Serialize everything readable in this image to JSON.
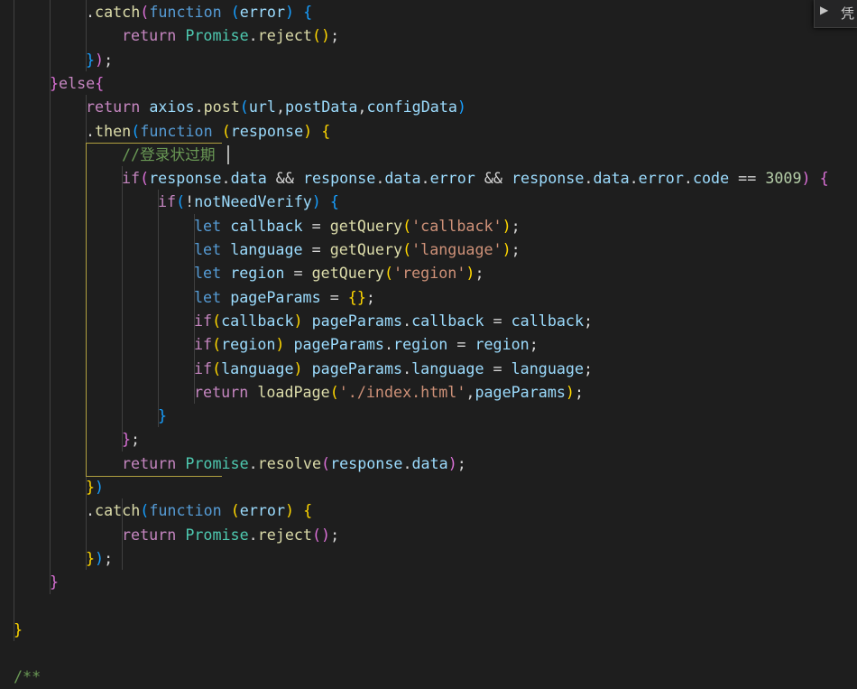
{
  "colors": {
    "background": "#1e1e1e",
    "default": "#d4d4d4",
    "keyword": "#c586c0",
    "storage": "#569cd6",
    "function": "#dcdcaa",
    "variable": "#9cdcfe",
    "class": "#4ec9b0",
    "string": "#ce9178",
    "number": "#b5cea8",
    "comment": "#6a9955",
    "bracket1": "#ffd700",
    "bracket2": "#da70d6",
    "bracket3": "#179fff"
  },
  "find_widget": {
    "toggle_icon": "chevron-right-icon",
    "label": "凭"
  },
  "lines": [
    [
      {
        "t": ".",
        "k": "default"
      },
      {
        "t": "catch",
        "k": "function"
      },
      {
        "t": "(",
        "k": "bracket2"
      },
      {
        "t": "function",
        "k": "storage"
      },
      {
        "t": " ",
        "k": "default"
      },
      {
        "t": "(",
        "k": "bracket3"
      },
      {
        "t": "error",
        "k": "variable"
      },
      {
        "t": ")",
        "k": "bracket3"
      },
      {
        "t": " ",
        "k": "default"
      },
      {
        "t": "{",
        "k": "bracket3"
      }
    ],
    [
      {
        "t": "return",
        "k": "keyword"
      },
      {
        "t": " ",
        "k": "default"
      },
      {
        "t": "Promise",
        "k": "class"
      },
      {
        "t": ".",
        "k": "default"
      },
      {
        "t": "reject",
        "k": "function"
      },
      {
        "t": "(",
        "k": "bracket1"
      },
      {
        "t": ")",
        "k": "bracket1"
      },
      {
        "t": ";",
        "k": "default"
      }
    ],
    [
      {
        "t": "}",
        "k": "bracket3"
      },
      {
        "t": ")",
        "k": "bracket2"
      },
      {
        "t": ";",
        "k": "default"
      }
    ],
    [
      {
        "t": "}",
        "k": "bracket2"
      },
      {
        "t": "else",
        "k": "keyword"
      },
      {
        "t": "{",
        "k": "bracket2"
      }
    ],
    [
      {
        "t": "return",
        "k": "keyword"
      },
      {
        "t": " ",
        "k": "default"
      },
      {
        "t": "axios",
        "k": "variable"
      },
      {
        "t": ".",
        "k": "default"
      },
      {
        "t": "post",
        "k": "function"
      },
      {
        "t": "(",
        "k": "bracket3"
      },
      {
        "t": "url",
        "k": "variable"
      },
      {
        "t": ",",
        "k": "default"
      },
      {
        "t": "postData",
        "k": "variable"
      },
      {
        "t": ",",
        "k": "default"
      },
      {
        "t": "configData",
        "k": "variable"
      },
      {
        "t": ")",
        "k": "bracket3"
      }
    ],
    [
      {
        "t": ".",
        "k": "default"
      },
      {
        "t": "then",
        "k": "function"
      },
      {
        "t": "(",
        "k": "bracket3"
      },
      {
        "t": "function",
        "k": "storage"
      },
      {
        "t": " ",
        "k": "default"
      },
      {
        "t": "(",
        "k": "bracket1"
      },
      {
        "t": "response",
        "k": "variable"
      },
      {
        "t": ")",
        "k": "bracket1"
      },
      {
        "t": " ",
        "k": "default"
      },
      {
        "t": "{",
        "k": "bracket1"
      }
    ],
    [
      {
        "t": "//登录状过期",
        "k": "comment"
      }
    ],
    [
      {
        "t": "if",
        "k": "keyword"
      },
      {
        "t": "(",
        "k": "bracket2"
      },
      {
        "t": "response",
        "k": "variable"
      },
      {
        "t": ".",
        "k": "default"
      },
      {
        "t": "data",
        "k": "variable"
      },
      {
        "t": " && ",
        "k": "default"
      },
      {
        "t": "response",
        "k": "variable"
      },
      {
        "t": ".",
        "k": "default"
      },
      {
        "t": "data",
        "k": "variable"
      },
      {
        "t": ".",
        "k": "default"
      },
      {
        "t": "error",
        "k": "variable"
      },
      {
        "t": " && ",
        "k": "default"
      },
      {
        "t": "response",
        "k": "variable"
      },
      {
        "t": ".",
        "k": "default"
      },
      {
        "t": "data",
        "k": "variable"
      },
      {
        "t": ".",
        "k": "default"
      },
      {
        "t": "error",
        "k": "variable"
      },
      {
        "t": ".",
        "k": "default"
      },
      {
        "t": "code",
        "k": "variable"
      },
      {
        "t": " == ",
        "k": "default"
      },
      {
        "t": "3009",
        "k": "number"
      },
      {
        "t": ")",
        "k": "bracket2"
      },
      {
        "t": " ",
        "k": "default"
      },
      {
        "t": "{",
        "k": "bracket2"
      }
    ],
    [
      {
        "t": "if",
        "k": "keyword"
      },
      {
        "t": "(",
        "k": "bracket3"
      },
      {
        "t": "!",
        "k": "default"
      },
      {
        "t": "notNeedVerify",
        "k": "variable"
      },
      {
        "t": ")",
        "k": "bracket3"
      },
      {
        "t": " ",
        "k": "default"
      },
      {
        "t": "{",
        "k": "bracket3"
      }
    ],
    [
      {
        "t": "let",
        "k": "storage"
      },
      {
        "t": " ",
        "k": "default"
      },
      {
        "t": "callback",
        "k": "variable"
      },
      {
        "t": " = ",
        "k": "default"
      },
      {
        "t": "getQuery",
        "k": "function"
      },
      {
        "t": "(",
        "k": "bracket1"
      },
      {
        "t": "'callback'",
        "k": "string"
      },
      {
        "t": ")",
        "k": "bracket1"
      },
      {
        "t": ";",
        "k": "default"
      }
    ],
    [
      {
        "t": "let",
        "k": "storage"
      },
      {
        "t": " ",
        "k": "default"
      },
      {
        "t": "language",
        "k": "variable"
      },
      {
        "t": " = ",
        "k": "default"
      },
      {
        "t": "getQuery",
        "k": "function"
      },
      {
        "t": "(",
        "k": "bracket1"
      },
      {
        "t": "'language'",
        "k": "string"
      },
      {
        "t": ")",
        "k": "bracket1"
      },
      {
        "t": ";",
        "k": "default"
      }
    ],
    [
      {
        "t": "let",
        "k": "storage"
      },
      {
        "t": " ",
        "k": "default"
      },
      {
        "t": "region",
        "k": "variable"
      },
      {
        "t": " = ",
        "k": "default"
      },
      {
        "t": "getQuery",
        "k": "function"
      },
      {
        "t": "(",
        "k": "bracket1"
      },
      {
        "t": "'region'",
        "k": "string"
      },
      {
        "t": ")",
        "k": "bracket1"
      },
      {
        "t": ";",
        "k": "default"
      }
    ],
    [
      {
        "t": "let",
        "k": "storage"
      },
      {
        "t": " ",
        "k": "default"
      },
      {
        "t": "pageParams",
        "k": "variable"
      },
      {
        "t": " = ",
        "k": "default"
      },
      {
        "t": "{",
        "k": "bracket1"
      },
      {
        "t": "}",
        "k": "bracket1"
      },
      {
        "t": ";",
        "k": "default"
      }
    ],
    [
      {
        "t": "if",
        "k": "keyword"
      },
      {
        "t": "(",
        "k": "bracket1"
      },
      {
        "t": "callback",
        "k": "variable"
      },
      {
        "t": ")",
        "k": "bracket1"
      },
      {
        "t": " ",
        "k": "default"
      },
      {
        "t": "pageParams",
        "k": "variable"
      },
      {
        "t": ".",
        "k": "default"
      },
      {
        "t": "callback",
        "k": "variable"
      },
      {
        "t": " = ",
        "k": "default"
      },
      {
        "t": "callback",
        "k": "variable"
      },
      {
        "t": ";",
        "k": "default"
      }
    ],
    [
      {
        "t": "if",
        "k": "keyword"
      },
      {
        "t": "(",
        "k": "bracket1"
      },
      {
        "t": "region",
        "k": "variable"
      },
      {
        "t": ")",
        "k": "bracket1"
      },
      {
        "t": " ",
        "k": "default"
      },
      {
        "t": "pageParams",
        "k": "variable"
      },
      {
        "t": ".",
        "k": "default"
      },
      {
        "t": "region",
        "k": "variable"
      },
      {
        "t": " = ",
        "k": "default"
      },
      {
        "t": "region",
        "k": "variable"
      },
      {
        "t": ";",
        "k": "default"
      }
    ],
    [
      {
        "t": "if",
        "k": "keyword"
      },
      {
        "t": "(",
        "k": "bracket1"
      },
      {
        "t": "language",
        "k": "variable"
      },
      {
        "t": ")",
        "k": "bracket1"
      },
      {
        "t": " ",
        "k": "default"
      },
      {
        "t": "pageParams",
        "k": "variable"
      },
      {
        "t": ".",
        "k": "default"
      },
      {
        "t": "language",
        "k": "variable"
      },
      {
        "t": " = ",
        "k": "default"
      },
      {
        "t": "language",
        "k": "variable"
      },
      {
        "t": ";",
        "k": "default"
      }
    ],
    [
      {
        "t": "return",
        "k": "keyword"
      },
      {
        "t": " ",
        "k": "default"
      },
      {
        "t": "loadPage",
        "k": "function"
      },
      {
        "t": "(",
        "k": "bracket1"
      },
      {
        "t": "'./index.html'",
        "k": "string"
      },
      {
        "t": ",",
        "k": "default"
      },
      {
        "t": "pageParams",
        "k": "variable"
      },
      {
        "t": ")",
        "k": "bracket1"
      },
      {
        "t": ";",
        "k": "default"
      }
    ],
    [
      {
        "t": "}",
        "k": "bracket3"
      }
    ],
    [
      {
        "t": "}",
        "k": "bracket2"
      },
      {
        "t": ";",
        "k": "default"
      }
    ],
    [
      {
        "t": "return",
        "k": "keyword"
      },
      {
        "t": " ",
        "k": "default"
      },
      {
        "t": "Promise",
        "k": "class"
      },
      {
        "t": ".",
        "k": "default"
      },
      {
        "t": "resolve",
        "k": "function"
      },
      {
        "t": "(",
        "k": "bracket2"
      },
      {
        "t": "response",
        "k": "variable"
      },
      {
        "t": ".",
        "k": "default"
      },
      {
        "t": "data",
        "k": "variable"
      },
      {
        "t": ")",
        "k": "bracket2"
      },
      {
        "t": ";",
        "k": "default"
      }
    ],
    [
      {
        "t": "}",
        "k": "bracket1"
      },
      {
        "t": ")",
        "k": "bracket3"
      }
    ],
    [
      {
        "t": ".",
        "k": "default"
      },
      {
        "t": "catch",
        "k": "function"
      },
      {
        "t": "(",
        "k": "bracket3"
      },
      {
        "t": "function",
        "k": "storage"
      },
      {
        "t": " ",
        "k": "default"
      },
      {
        "t": "(",
        "k": "bracket1"
      },
      {
        "t": "error",
        "k": "variable"
      },
      {
        "t": ")",
        "k": "bracket1"
      },
      {
        "t": " ",
        "k": "default"
      },
      {
        "t": "{",
        "k": "bracket1"
      }
    ],
    [
      {
        "t": "return",
        "k": "keyword"
      },
      {
        "t": " ",
        "k": "default"
      },
      {
        "t": "Promise",
        "k": "class"
      },
      {
        "t": ".",
        "k": "default"
      },
      {
        "t": "reject",
        "k": "function"
      },
      {
        "t": "(",
        "k": "bracket2"
      },
      {
        "t": ")",
        "k": "bracket2"
      },
      {
        "t": ";",
        "k": "default"
      }
    ],
    [
      {
        "t": "}",
        "k": "bracket1"
      },
      {
        "t": ")",
        "k": "bracket3"
      },
      {
        "t": ";",
        "k": "default"
      }
    ],
    [
      {
        "t": "}",
        "k": "bracket2"
      }
    ],
    [],
    [
      {
        "t": "}",
        "k": "bracket1"
      }
    ],
    [],
    [
      {
        "t": "/**",
        "k": "comment"
      }
    ]
  ]
}
